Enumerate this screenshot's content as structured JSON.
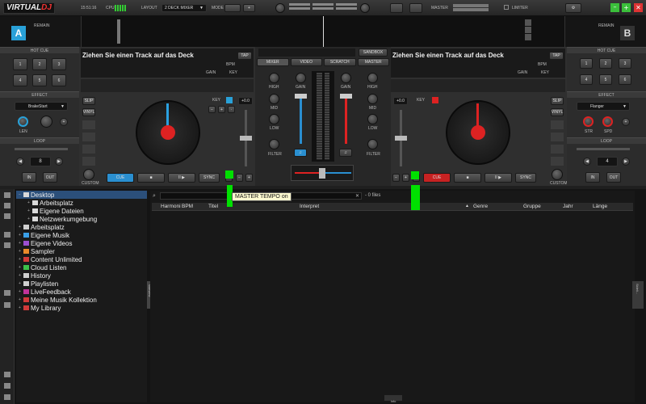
{
  "app": {
    "logo_virtual": "VIRTUAL",
    "logo_dj": "DJ"
  },
  "topbar": {
    "clock": "15:51:16",
    "cpu_label": "CPU",
    "layout_label": "LAYOUT",
    "layout_value": "2 DECK MIXER",
    "mode_label": "MODE",
    "master_label": "MASTER",
    "limiter_label": "LIMITER"
  },
  "waveform": {
    "left_label": "REMAIN",
    "right_label": "REMAIN"
  },
  "decks": {
    "left": {
      "letter": "A",
      "title": "Ziehen Sie einen Track auf das Deck",
      "tap": "TAP",
      "bpm": "BPM",
      "gain": "GAIN",
      "key": "KEY",
      "key_small": "KEY",
      "pitch_value": "+0.0",
      "slip": "SLIP",
      "vinyl": "VINYL",
      "custom": "CUSTOM",
      "cue": "CUE",
      "stop": "■",
      "play": "II ▶",
      "sync": "SYNC",
      "hotcue_head": "HOT CUE",
      "hotcues": [
        "1",
        "2",
        "3",
        "4",
        "5",
        "6"
      ],
      "effect_head": "EFFECT",
      "effect_name": "BrakeStart",
      "effect_knob": "LEN",
      "loop_head": "LOOP",
      "loop_value": "8",
      "loop_in": "IN",
      "loop_out": "OUT"
    },
    "right": {
      "letter": "B",
      "title": "Ziehen Sie einen Track auf das Deck",
      "tap": "TAP",
      "bpm": "BPM",
      "gain": "GAIN",
      "key": "KEY",
      "key_small": "KEY",
      "pitch_value": "+0.0",
      "slip": "SLIP",
      "vinyl": "VINYL",
      "custom": "CUSTOM",
      "cue": "CUE",
      "stop": "■",
      "play": "II ▶",
      "sync": "SYNC",
      "hotcue_head": "HOT CUE",
      "hotcues": [
        "1",
        "2",
        "3",
        "4",
        "5",
        "6"
      ],
      "effect_head": "EFFECT",
      "effect_name": "Flanger",
      "effect_knob1": "STR",
      "effect_knob2": "SPD",
      "loop_head": "LOOP",
      "loop_value": "4",
      "loop_in": "IN",
      "loop_out": "OUT"
    }
  },
  "mixer": {
    "tabs": [
      "MIXER",
      "VIDEO",
      "SCRATCH",
      "MASTER"
    ],
    "sandbox": "SANDBOX",
    "knobs": [
      "HIGH",
      "MID",
      "LOW",
      "FILTER"
    ],
    "gain": "GAIN"
  },
  "tooltip": "MASTER TEMPO on",
  "browser": {
    "search_placeholder": "",
    "file_count": "- 0 files",
    "columns": [
      "Harmoni",
      "BPM",
      "Titel",
      "Interpret",
      "Genre",
      "Gruppe",
      "Jahr",
      "Länge"
    ],
    "sideview": "sideview",
    "info": "Info",
    "sidelist": "Sideli...",
    "tree": [
      {
        "label": "Desktop",
        "color": "#d9d9d9",
        "indent": 0
      },
      {
        "label": "Arbeitsplatz",
        "color": "#d9d9d9",
        "indent": 1
      },
      {
        "label": "Eigene Dateien",
        "color": "#d9d9d9",
        "indent": 1
      },
      {
        "label": "Netzwerkumgebung",
        "color": "#d9d9d9",
        "indent": 1
      },
      {
        "label": "Arbeitsplatz",
        "color": "#cfcfcf",
        "indent": 0
      },
      {
        "label": "Eigene Musik",
        "color": "#3aa0e8",
        "indent": 0
      },
      {
        "label": "Eigene Videos",
        "color": "#9b4fd0",
        "indent": 0
      },
      {
        "label": "Sampler",
        "color": "#e88a2a",
        "indent": 0
      },
      {
        "label": "Content Unlimited",
        "color": "#d03a3a",
        "indent": 0
      },
      {
        "label": "Cloud Listen",
        "color": "#3cc04a",
        "indent": 0
      },
      {
        "label": "History",
        "color": "#cfcfcf",
        "indent": 0
      },
      {
        "label": "Playlisten",
        "color": "#cfcfcf",
        "indent": 0
      },
      {
        "label": "LiveFeedback",
        "color": "#c0339a",
        "indent": 0
      },
      {
        "label": "Meine Musik Kollektion",
        "color": "#d03a3a",
        "indent": 0
      },
      {
        "label": "My Library",
        "color": "#d03a3a",
        "indent": 0
      }
    ]
  }
}
